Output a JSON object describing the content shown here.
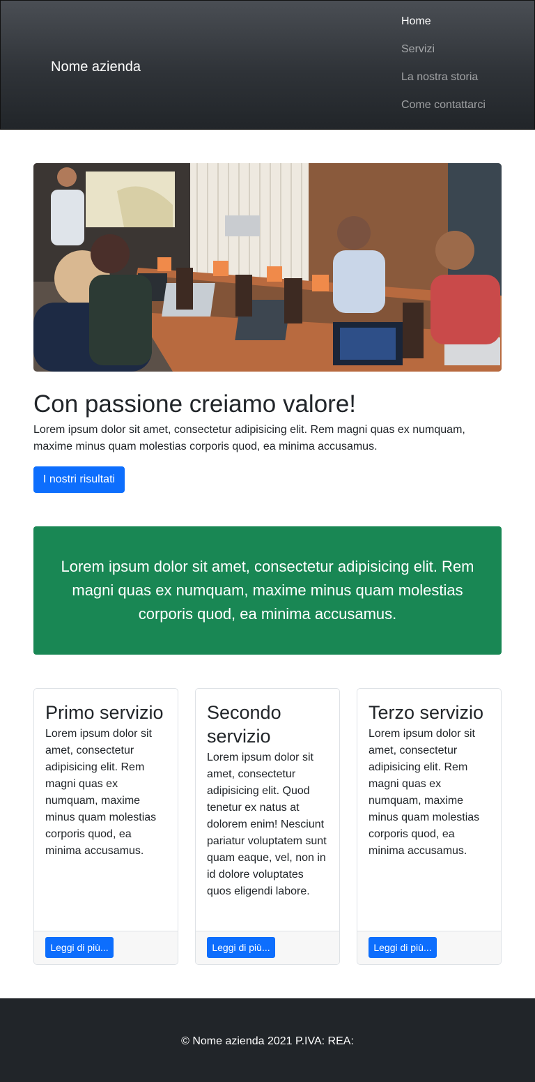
{
  "navbar": {
    "brand": "Nome azienda",
    "links": [
      {
        "label": "Home"
      },
      {
        "label": "Servizi"
      },
      {
        "label": "La nostra storia"
      },
      {
        "label": "Come contattarci"
      }
    ]
  },
  "hero": {
    "title": "Con passione creiamo valore!",
    "text": "Lorem ipsum dolor sit amet, consectetur adipisicing elit. Rem magni quas ex numquam, maxime minus quam molestias corporis quod, ea minima accusamus.",
    "button_label": "I nostri risultati"
  },
  "callout": {
    "text": "Lorem ipsum dolor sit amet, consectetur adipisicing elit. Rem magni quas ex numquam, maxime minus quam molestias corporis quod, ea minima accusamus."
  },
  "services": [
    {
      "title": "Primo servizio",
      "text": "Lorem ipsum dolor sit amet, consectetur adipisicing elit. Rem magni quas ex numquam, maxime minus quam molestias corporis quod, ea minima accusamus.",
      "button_label": "Leggi di più..."
    },
    {
      "title": "Secondo servizio",
      "text": "Lorem ipsum dolor sit amet, consectetur adipisicing elit. Quod tenetur ex natus at dolorem enim! Nesciunt pariatur voluptatem sunt quam eaque, vel, non in id dolore voluptates quos eligendi labore.",
      "button_label": "Leggi di più..."
    },
    {
      "title": "Terzo servizio",
      "text": "Lorem ipsum dolor sit amet, consectetur adipisicing elit. Rem magni quas ex numquam, maxime minus quam molestias corporis quod, ea minima accusamus.",
      "button_label": "Leggi di più..."
    }
  ],
  "footer": {
    "text": "© Nome azienda 2021 P.IVA: REA:"
  },
  "colors": {
    "primary": "#0d6efd",
    "success": "#198754",
    "dark": "#212529"
  }
}
